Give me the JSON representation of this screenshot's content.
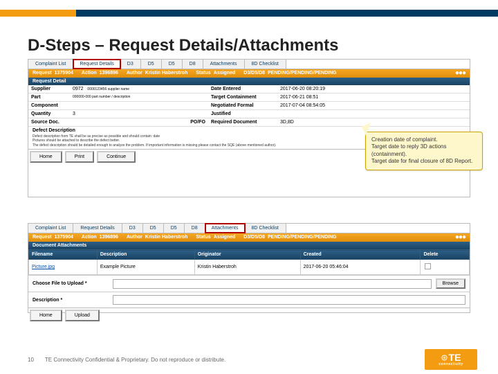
{
  "slide": {
    "title": "D-Steps – Request Details/Attachments",
    "page_number": "10",
    "confidential": "TE Connectivity Confidential & Proprietary. Do not reproduce or distribute."
  },
  "logo": {
    "brand_top": "TE",
    "brand_bottom": "connectivity"
  },
  "callout": {
    "l1": "Creation date of complaint.",
    "l2": "Target date to reply 3D actions (containment).",
    "l3": "Target date for final closure of 8D Report."
  },
  "tabs_top": {
    "t0": "Complaint List",
    "t1": "Request Details",
    "t2": "D3",
    "t3": "D5",
    "t4": "D5",
    "t5": "D8",
    "t6": "Attachments",
    "t7": "8D Checklist"
  },
  "request_row": {
    "request_label": "Request",
    "request_val": "1375904",
    "action_label": "Action",
    "action_val": "1396896",
    "author_label": "Author",
    "author_val": "Kristin Haberstroh",
    "status_label": "Status",
    "status_val": "Assigned",
    "d_label": "D3/D5/D8",
    "d_val": "PENDING/PENDING/PENDING"
  },
  "detail": {
    "section_title": "Request Detail",
    "supplier_lbl": "Supplier",
    "supplier_code": "0972",
    "supplier_name": "0000123456 supplier name",
    "part_lbl": "Part",
    "part_val": "000000-000 part number / description",
    "component_lbl": "Component",
    "component_val": "",
    "quantity_lbl": "Quantity",
    "quantity_val": "3",
    "source_lbl": "Source Doc.",
    "source_val": "",
    "po_lbl": "PO/FO",
    "po_val": "",
    "date_entered_lbl": "Date Entered",
    "date_entered_val": "2017-06-20 08:20:19",
    "target_cont_lbl": "Target Containment",
    "target_cont_val": "2017-06-21 08:51",
    "neg_formal_lbl": "Negotiated Formal",
    "neg_formal_val": "2017-07-04 08:54:05",
    "justified_lbl": "Justified",
    "justified_val": "",
    "req_doc_lbl": "Required Document",
    "req_doc_val": "3D,8D"
  },
  "defect": {
    "heading": "Defect Description",
    "l1": "Defect description from TE shall be as precise as possible and should contain: date",
    "l2": "Pictures should be attached to describe the defect better.",
    "l3": "The defect description should be detailed enough to analyze the problem. If important information is missing please contact the SQE (above mentioned author)."
  },
  "buttons_top": {
    "home": "Home",
    "print": "Print",
    "continue": "Continue"
  },
  "tabs_bottom": {
    "t0": "Complaint List",
    "t1": "Request Details",
    "t2": "D3",
    "t3": "D5",
    "t4": "D5",
    "t5": "D8",
    "t6": "Attachments",
    "t7": "8D Checklist"
  },
  "attachments": {
    "section_title": "Document Attachments",
    "col_filename": "Filename",
    "col_description": "Description",
    "col_originator": "Originator",
    "col_created": "Created",
    "col_delete": "Delete",
    "row0": {
      "filename": "Picture.jpg",
      "description": "Example Picture",
      "originator": "Kristin Haberstroh",
      "created": "2017-06-20 05:46:04"
    },
    "choose_lbl": "Choose File to Upload *",
    "desc_lbl": "Description *",
    "browse_btn": "Browse",
    "home_btn": "Home",
    "upload_btn": "Upload"
  }
}
